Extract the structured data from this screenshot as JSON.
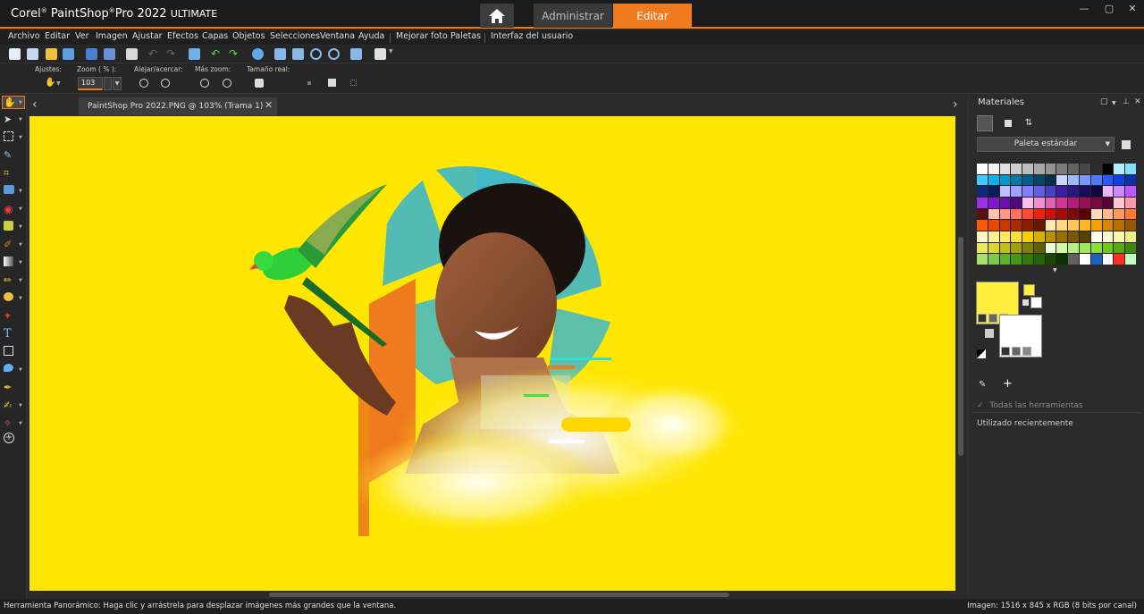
{
  "app": {
    "brand": "Corel",
    "name": "PaintShop",
    "name_sup": "®",
    "name2": "Pro 2022",
    "edition": "ULTIMATE"
  },
  "workspace_tabs": {
    "manage": "Administrar",
    "edit": "Editar"
  },
  "window_controls": {
    "min": "—",
    "max": "▢",
    "close": "✕"
  },
  "menu": [
    "Archivo",
    "Editar",
    "Ver",
    "Imagen",
    "Ajustar",
    "Efectos",
    "Capas",
    "Objetos",
    "Selecciones",
    "Ventana",
    "Ayuda",
    "Mejorar foto",
    "Paletas",
    "Interfaz del usuario"
  ],
  "options": {
    "presets_label": "Ajustes:",
    "zoom_label": "Zoom ( % ):",
    "zoom_value": "103",
    "zoom_out_in_label": "Alejar/acercar:",
    "more_zoom_label": "Más zoom:",
    "actual_size_label": "Tamaño real:"
  },
  "document": {
    "tab_title": "PaintShop Pro 2022.PNG @ 103% (Trama 1)",
    "close": "✕",
    "nav_left": "‹",
    "nav_right": "›"
  },
  "canvas": {
    "background": "#ffe600"
  },
  "status": {
    "message": "Herramienta Panorámico: Haga clic y arrástrela para desplazar imágenes más grandes que la ventana.",
    "image_info": "Imagen:  1516 x 845 x RGB (8 bits por canal)"
  },
  "materials": {
    "title": "Materiales",
    "palette_select": "Paleta estándar",
    "all_tools": "Todas las herramientas",
    "recently_used": "Utilizado recientemente",
    "foreground": "#ffee3b",
    "background": "#ffffff",
    "swatches": [
      "#ffffff",
      "#f2f2f2",
      "#e0e0e0",
      "#cfcfcf",
      "#bdbdbd",
      "#a8a8a8",
      "#939393",
      "#7c7c7c",
      "#636363",
      "#474747",
      "#2c2c2c",
      "#000000",
      "#b3ecff",
      "#7fe0ff",
      "#40c8ff",
      "#10b0e8",
      "#0898c8",
      "#087aa8",
      "#085e88",
      "#084468",
      "#0a2e4a",
      "#c8d8ff",
      "#a0b8ff",
      "#7898ff",
      "#5078ff",
      "#2858ff",
      "#1040e0",
      "#1030a8",
      "#102878",
      "#0c1c58",
      "#c0c0ff",
      "#a0a0ff",
      "#8080ff",
      "#6060e0",
      "#4840c0",
      "#3820a0",
      "#281880",
      "#180c58",
      "#100840",
      "#e8b8ff",
      "#d088ff",
      "#b858ff",
      "#a030e8",
      "#8018c8",
      "#6810a8",
      "#500880",
      "#f8c0e8",
      "#f090d0",
      "#e060b8",
      "#d03898",
      "#b81878",
      "#981058",
      "#780840",
      "#580430",
      "#ffc8d0",
      "#ff98a8",
      "#581010",
      "#ffc0b0",
      "#ff9888",
      "#ff7060",
      "#ff4838",
      "#f02010",
      "#d01008",
      "#a80c08",
      "#800808",
      "#580404",
      "#ffd8c0",
      "#ffb890",
      "#ff9860",
      "#ff7830",
      "#ff5800",
      "#e84800",
      "#c83800",
      "#a82c00",
      "#882000",
      "#681800",
      "#ffe8b0",
      "#ffd880",
      "#ffc850",
      "#ffb820",
      "#f8a000",
      "#d88800",
      "#b87000",
      "#985800",
      "#fff8c0",
      "#fff090",
      "#ffe860",
      "#ffe030",
      "#f8d000",
      "#d8b000",
      "#b89000",
      "#987000",
      "#785800",
      "#584000",
      "#fffff0",
      "#ffffd0",
      "#f8f8a8",
      "#f0f080",
      "#e8e858",
      "#d8d830",
      "#c0c010",
      "#a0a008",
      "#808008",
      "#606004",
      "#e8ffd0",
      "#d0f8a8",
      "#b8f080",
      "#a0e858",
      "#88e030",
      "#70c818",
      "#58a810",
      "#408808",
      "#a8e070",
      "#80c850",
      "#60b030",
      "#489818",
      "#387808",
      "#286004",
      "#184804",
      "#0c3000",
      "#606060",
      "#ffffff",
      "#2060c0",
      "#ffffff",
      "#ff3020",
      "#c0ffc0"
    ]
  }
}
